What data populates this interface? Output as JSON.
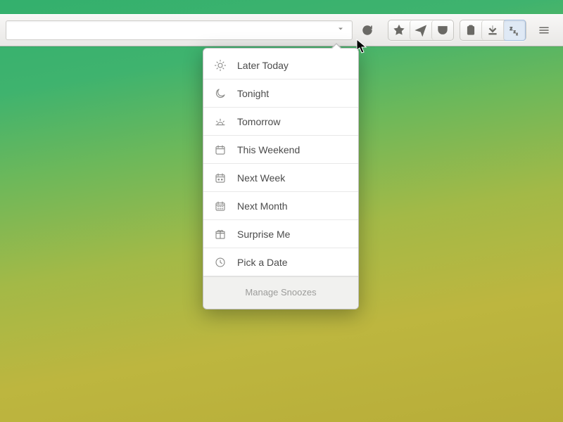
{
  "menu": {
    "items": [
      {
        "label": "Later Today"
      },
      {
        "label": "Tonight"
      },
      {
        "label": "Tomorrow"
      },
      {
        "label": "This Weekend"
      },
      {
        "label": "Next Week"
      },
      {
        "label": "Next Month"
      },
      {
        "label": "Surprise Me"
      },
      {
        "label": "Pick a Date"
      }
    ],
    "footer": "Manage Snoozes"
  }
}
